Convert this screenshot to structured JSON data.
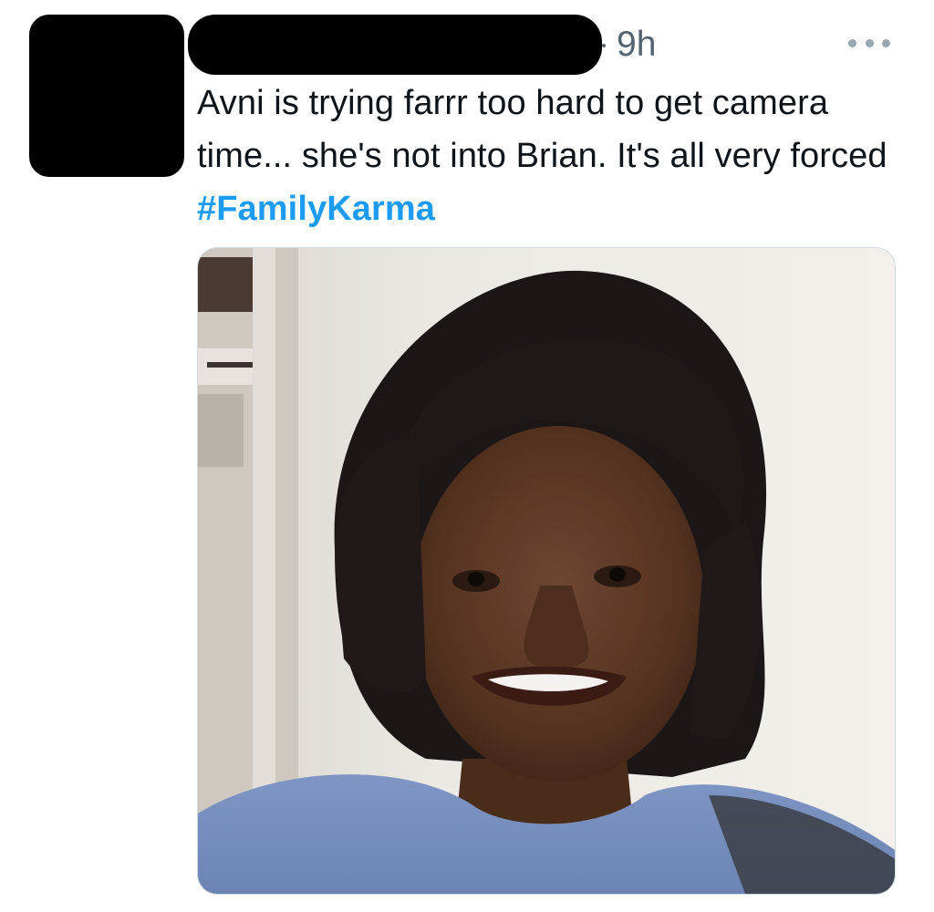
{
  "tweet": {
    "timestamp": "9h",
    "text_before": "Avni is trying farrr too hard to get camera time... she's not into Brian. It's all very forced ",
    "hashtag": "#FamilyKarma"
  },
  "colors": {
    "hashtag": "#1d9bf0",
    "meta_text": "#536471",
    "redaction": "#000000"
  },
  "icons": {
    "more": "more-horizontal-icon"
  }
}
